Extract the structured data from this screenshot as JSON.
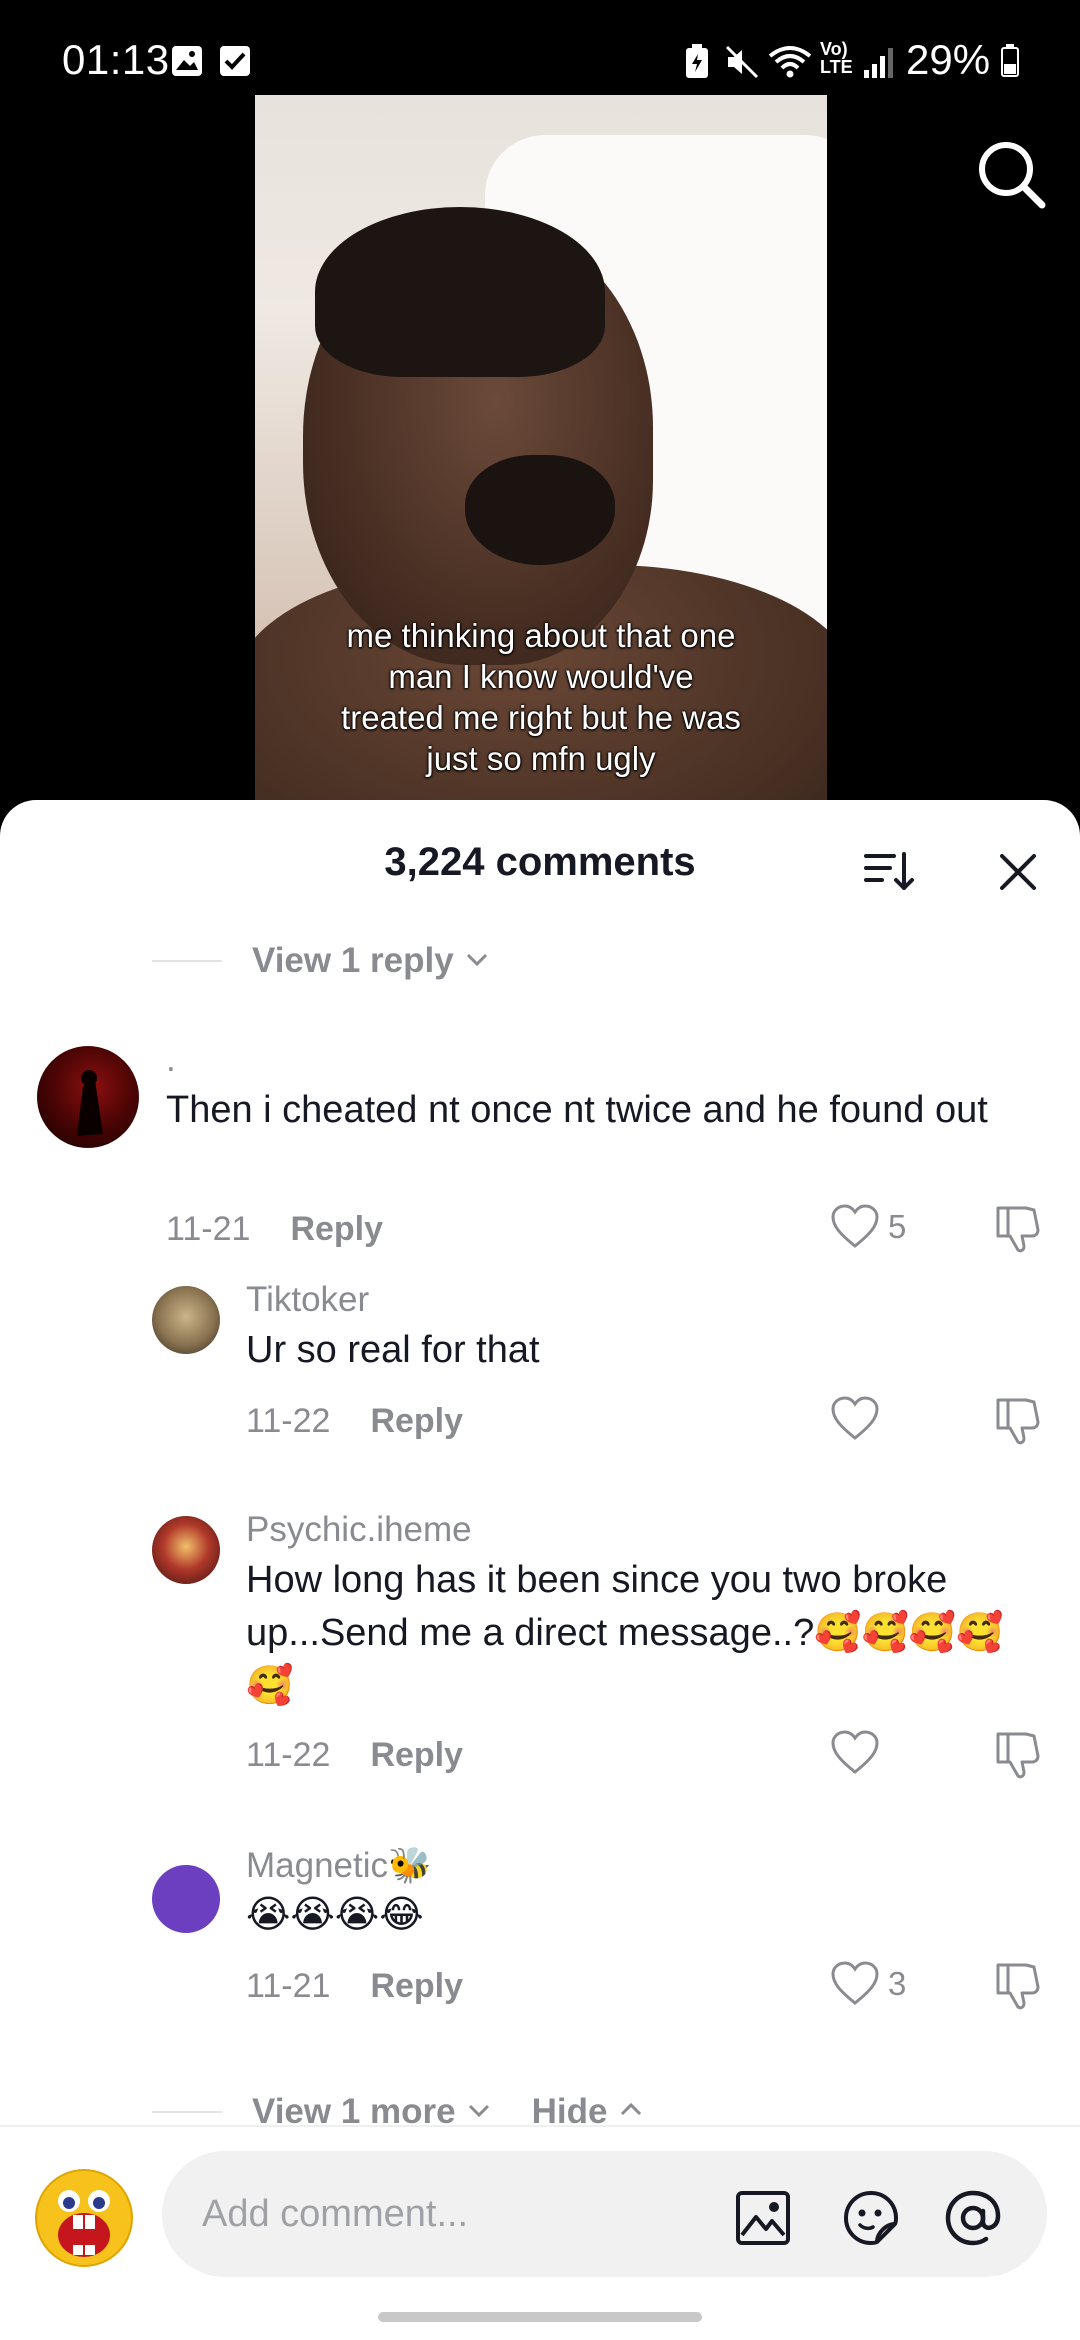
{
  "status_bar": {
    "time": "01:13",
    "battery": "29%"
  },
  "video": {
    "caption_lines": [
      "me thinking about that one",
      "man I know would've",
      "treated me right but he was",
      "just so mfn ugly"
    ]
  },
  "comments_sheet": {
    "title": "3,224 comments",
    "view_reply": "View 1 reply",
    "comments": [
      {
        "user": ".",
        "text": "Then i cheated nt once nt twice and he found out",
        "date": "11-21",
        "reply_label": "Reply",
        "likes": "5"
      },
      {
        "user": "Tiktoker",
        "text": "Ur so real for that",
        "date": "11-22",
        "reply_label": "Reply",
        "likes": ""
      },
      {
        "user": "Psychic.iheme",
        "text": "How long has it been since you two broke up...Send me a direct message..?🥰🥰🥰🥰🥰",
        "date": "11-22",
        "reply_label": "Reply",
        "likes": ""
      },
      {
        "user": "Magnetic🐝",
        "text": "😭😭😭😂",
        "date": "11-21",
        "reply_label": "Reply",
        "likes": "3"
      }
    ],
    "view_more": "View 1 more",
    "hide": "Hide"
  },
  "input_bar": {
    "placeholder": "Add comment..."
  },
  "colors": {
    "sheet_bg": "#ffffff",
    "text_primary": "#161823",
    "text_secondary": "#8a8b91",
    "avatar_purple": "#6b3fbf"
  }
}
